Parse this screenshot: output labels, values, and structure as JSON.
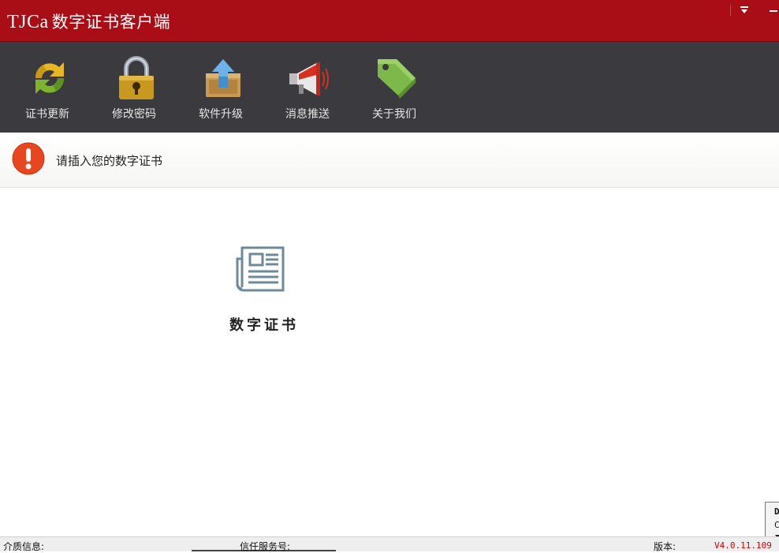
{
  "window": {
    "brand": "TJCa",
    "app_name": "数字证书客户端"
  },
  "window_controls": {
    "menu_icon": "dropdown-triangle-icon",
    "minimize_icon": "minimize-icon"
  },
  "toolbar": {
    "items": [
      {
        "label": "证书更新",
        "icon": "refresh-arrows-icon"
      },
      {
        "label": "修改密码",
        "icon": "padlock-icon"
      },
      {
        "label": "软件升级",
        "icon": "upgrade-box-icon"
      },
      {
        "label": "消息推送",
        "icon": "megaphone-icon"
      },
      {
        "label": "关于我们",
        "icon": "tag-icon"
      }
    ]
  },
  "notice": {
    "icon": "warning-icon",
    "message": "请插入您的数字证书"
  },
  "certificate": {
    "icon": "document-icon",
    "label": "数字证书"
  },
  "statusbar": {
    "medium_label": "介质信息:",
    "trust_label": "信任服务号:",
    "version_label": "版本:",
    "version_value": "V4.0.11.109"
  },
  "sidetab": {
    "char1": "D",
    "char2": "C"
  },
  "colors": {
    "title_bg": "#a90d16",
    "toolbar_bg": "#3b3a3e",
    "version_red": "#cc0000",
    "warning_orange": "#e8461e"
  }
}
